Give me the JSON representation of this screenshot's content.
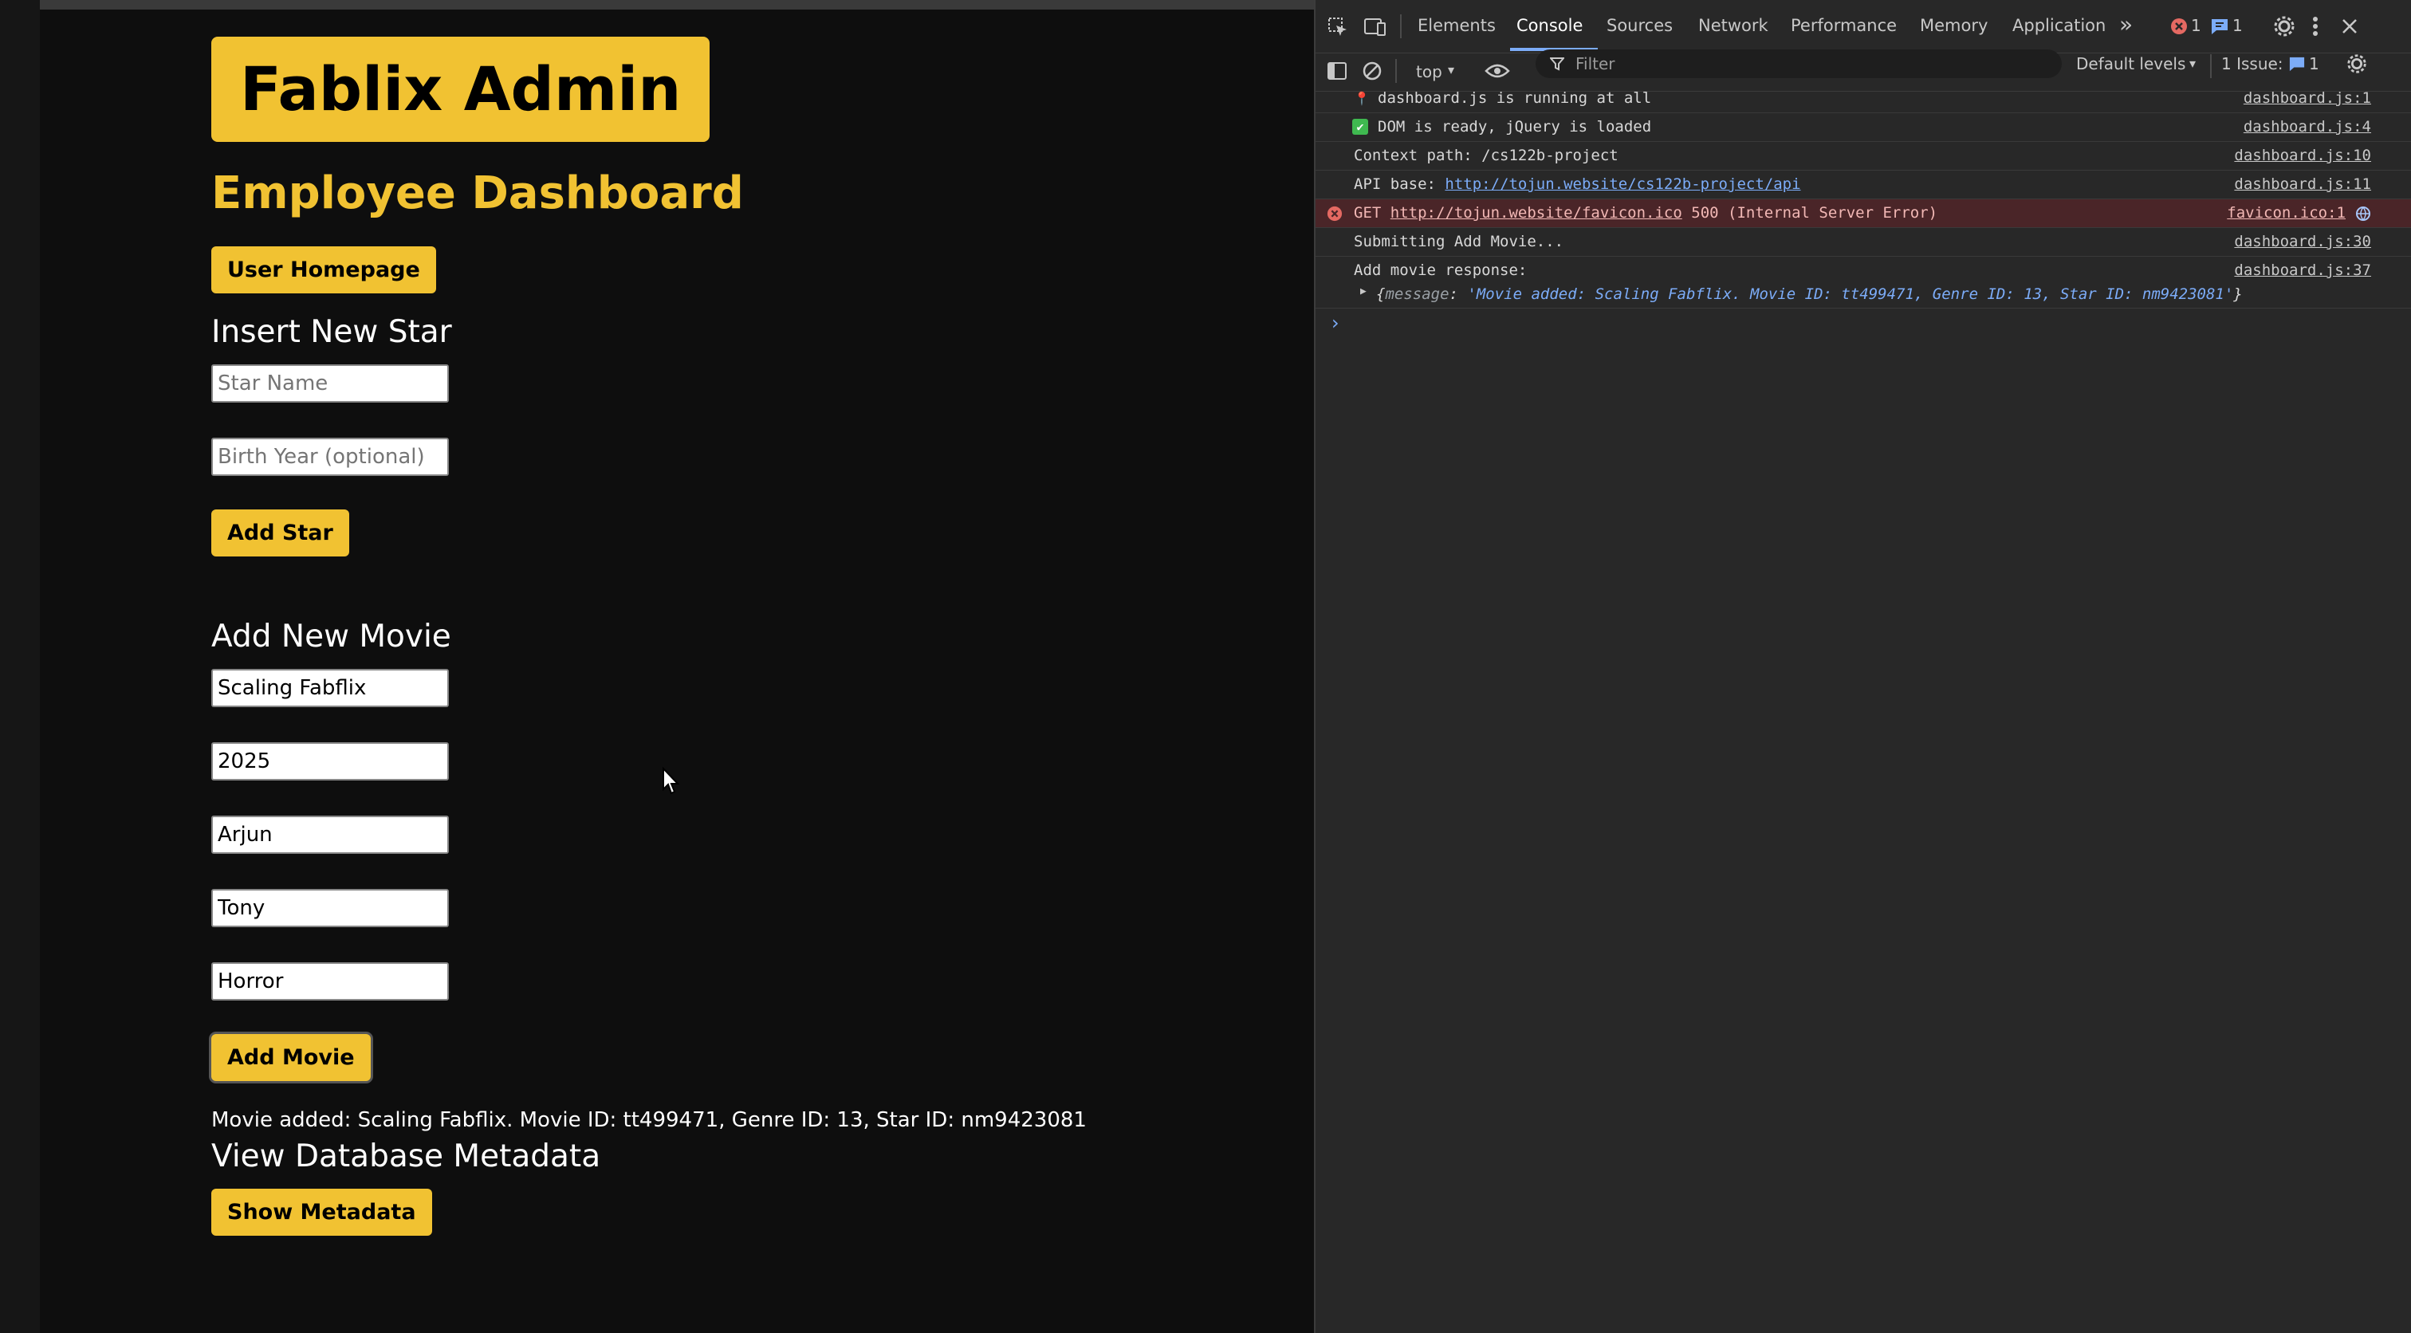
{
  "page": {
    "logo": "Fablix Admin",
    "title": "Employee Dashboard",
    "user_homepage_btn": "User Homepage",
    "insert_star": {
      "heading": "Insert New Star",
      "star_name_placeholder": "Star Name",
      "birth_year_placeholder": "Birth Year (optional)",
      "button": "Add Star"
    },
    "add_movie": {
      "heading": "Add New Movie",
      "fields": [
        "Scaling Fabflix",
        "2025",
        "Arjun",
        "Tony",
        "Horror"
      ],
      "button": "Add Movie",
      "message": "Movie added: Scaling Fabflix. Movie ID: tt499471, Genre ID: 13, Star ID: nm9423081"
    },
    "metadata": {
      "heading": "View Database Metadata",
      "button": "Show Metadata"
    },
    "colors": {
      "accent": "#f1c232",
      "background": "#0e0e0e"
    }
  },
  "devtools": {
    "tabs": [
      "Elements",
      "Console",
      "Sources",
      "Network",
      "Performance",
      "Memory",
      "Application"
    ],
    "active_tab": "Console",
    "error_count": "1",
    "info_count": "1",
    "context": "top",
    "filter_placeholder": "Filter",
    "levels": "Default levels",
    "issues_label": "1 Issue:",
    "issues_count": "1",
    "console": [
      {
        "text": "dashboard.js is running at all",
        "source": "dashboard.js:1"
      },
      {
        "text": "DOM is ready, jQuery is loaded",
        "source": "dashboard.js:4"
      },
      {
        "text": "Context path: /cs122b-project",
        "source": "dashboard.js:10"
      },
      {
        "prefix": "API base: ",
        "link": "http://tojun.website/cs122b-project/api",
        "source": "dashboard.js:11"
      },
      {
        "prefix": "GET ",
        "link": "http://tojun.website/favicon.ico",
        "suffix": " 500 (Internal Server Error)",
        "source": "favicon.ico:1"
      },
      {
        "text": "Submitting Add Movie...",
        "source": "dashboard.js:30"
      },
      {
        "text": "Add movie response:",
        "source": "dashboard.js:37"
      }
    ],
    "response_object": {
      "key": "message",
      "value": "'Movie added: Scaling Fabflix. Movie ID: tt499471, Genre ID: 13, Star ID: nm9423081'"
    },
    "prompt": "›"
  }
}
